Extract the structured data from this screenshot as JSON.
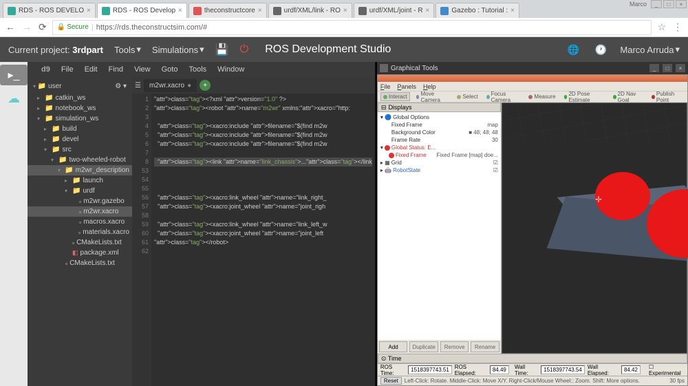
{
  "os": {
    "user": "Marco"
  },
  "browser": {
    "tabs": [
      {
        "title": "RDS - ROS DEVELO",
        "fav": "green"
      },
      {
        "title": "RDS - ROS Develop",
        "fav": "green",
        "active": true
      },
      {
        "title": "theconstructcore",
        "fav": "red"
      },
      {
        "title": "urdf/XML/link - RO",
        "fav": "grid"
      },
      {
        "title": "urdf/XML/joint - R",
        "fav": "grid"
      },
      {
        "title": "Gazebo : Tutorial :",
        "fav": "blue"
      }
    ],
    "secure_label": "Secure",
    "url": "https://rds.theconstructsim.com/#"
  },
  "rds": {
    "project_label": "Current project:",
    "project_name": "3rdpart",
    "menus": [
      "Tools",
      "Simulations"
    ],
    "title": "ROS Development Studio",
    "user": "Marco Arruda"
  },
  "c9": {
    "menus": [
      "File",
      "Edit",
      "Find",
      "View",
      "Goto",
      "Tools",
      "Window"
    ],
    "brand": "d9",
    "tree_root": "user",
    "tree": [
      {
        "d": 1,
        "t": "folder",
        "n": "catkin_ws",
        "open": false
      },
      {
        "d": 1,
        "t": "folder",
        "n": "notebook_ws",
        "open": false
      },
      {
        "d": 1,
        "t": "folder",
        "n": "simulation_ws",
        "open": true
      },
      {
        "d": 2,
        "t": "folder",
        "n": "build",
        "open": false
      },
      {
        "d": 2,
        "t": "folder",
        "n": "devel",
        "open": false
      },
      {
        "d": 2,
        "t": "folder",
        "n": "src",
        "open": true
      },
      {
        "d": 3,
        "t": "folder",
        "n": "two-wheeled-robot",
        "open": true
      },
      {
        "d": 4,
        "t": "folder",
        "n": "m2wr_description",
        "open": true,
        "sel": true
      },
      {
        "d": 5,
        "t": "folder",
        "n": "launch",
        "open": false
      },
      {
        "d": 5,
        "t": "folder",
        "n": "urdf",
        "open": true
      },
      {
        "d": 6,
        "t": "file",
        "n": "m2wr.gazebo"
      },
      {
        "d": 6,
        "t": "file",
        "n": "m2wr.xacro",
        "sel": true
      },
      {
        "d": 6,
        "t": "file",
        "n": "macros.xacro"
      },
      {
        "d": 6,
        "t": "file",
        "n": "materials.xacro"
      },
      {
        "d": 5,
        "t": "file",
        "n": "CMakeLists.txt"
      },
      {
        "d": 5,
        "t": "file-x",
        "n": "package.xml"
      },
      {
        "d": 4,
        "t": "file",
        "n": "CMakeLists.txt"
      }
    ],
    "editor_tab": "m2wr.xacro",
    "gutter": [
      "1",
      "2",
      "3",
      "4",
      "5",
      "6",
      "7",
      "8",
      "53",
      "54",
      "55",
      "56",
      "57",
      "58",
      "59",
      "60",
      "61",
      "62"
    ],
    "code_lines": [
      "<?xml version=\"1.0\" ?>",
      "<robot name=\"m2wr\" xmlns:xacro=\"http:",
      "",
      "  <xacro:include filename=\"$(find m2w",
      "  <xacro:include filename=\"$(find m2w",
      "  <xacro:include filename=\"$(find m2w",
      "",
      "  <link name=\"link_chassis\">...</link",
      "",
      "",
      "",
      "  <xacro:link_wheel name=\"link_right_",
      "  <xacro:joint_wheel name=\"joint_righ",
      "",
      "  <xacro:link_wheel name=\"link_left_w",
      "  <xacro:joint_wheel name=\"joint_left",
      "</robot>",
      ""
    ],
    "highlight_line": 7
  },
  "gt": {
    "title": "Graphical Tools",
    "rviz": {
      "menus": [
        "File",
        "Panels",
        "Help"
      ],
      "toolbar": [
        {
          "label": "Interact",
          "active": true,
          "color": "#6a6"
        },
        {
          "label": "Move Camera",
          "color": "#88a"
        },
        {
          "label": "Select",
          "color": "#aa6"
        },
        {
          "label": "Focus Camera",
          "color": "#6aa"
        },
        {
          "label": "Measure",
          "color": "#a66"
        },
        {
          "label": "2D Pose Estimate",
          "color": "#3a3"
        },
        {
          "label": "2D Nav Goal",
          "color": "#3a3"
        },
        {
          "label": "Publish Point",
          "color": "#a33"
        }
      ],
      "displays_label": "Displays",
      "displays": {
        "global_options": "Global Options",
        "fixed_frame_label": "Fixed Frame",
        "fixed_frame_value": "map",
        "bg_label": "Background Color",
        "bg_value": "48; 48; 48",
        "frame_rate_label": "Frame Rate",
        "frame_rate_value": "30",
        "global_status": "Global Status: E...",
        "fixed_frame_err": "Fixed Frame",
        "fixed_frame_err_val": "Fixed Frame [map] doe...",
        "grid": "Grid",
        "robot_state": "RobotState"
      },
      "buttons": {
        "add": "Add",
        "dup": "Duplicate",
        "rem": "Remove",
        "ren": "Rename"
      },
      "time_label": "Time",
      "status": {
        "ros_time_label": "ROS Time:",
        "ros_time": "1518397743.51",
        "ros_elapsed_label": "ROS Elapsed:",
        "ros_elapsed": "84.49",
        "wall_time_label": "Wall Time:",
        "wall_time": "1518397743.54",
        "wall_elapsed_label": "Wall Elapsed:",
        "wall_elapsed": "84.42",
        "experimental": "Experimental"
      },
      "help": {
        "reset": "Reset",
        "text": "Left-Click: Rotate.  Middle-Click: Move X/Y.  Right-Click/Mouse Wheel:: Zoom.  Shift: More options.",
        "fps": "30 fps"
      }
    }
  }
}
